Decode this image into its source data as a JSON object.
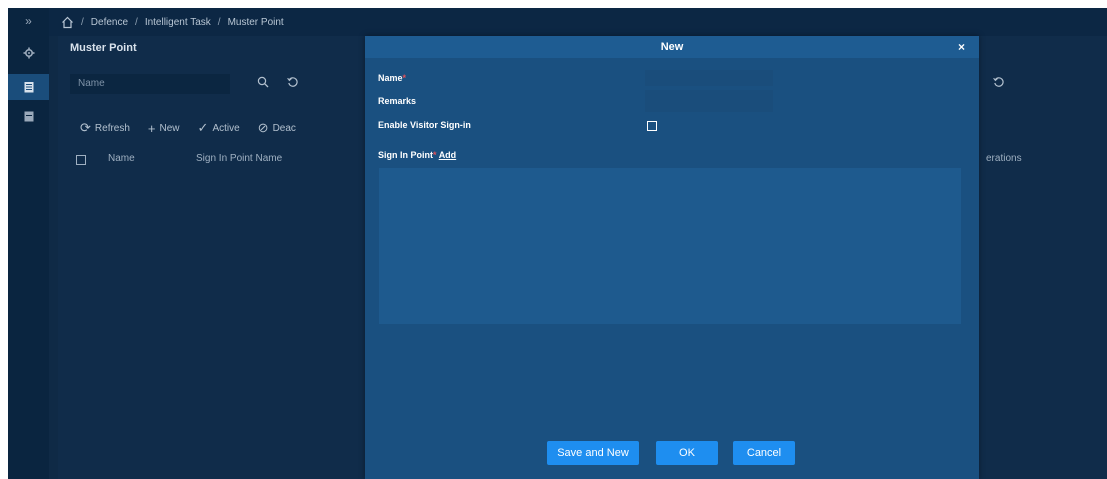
{
  "breadcrumb": {
    "items": [
      "Defence",
      "Intelligent Task",
      "Muster Point"
    ],
    "separator": "/"
  },
  "rail": {
    "expand_glyph": "»",
    "icons": [
      "gear-icon",
      "clipboard-icon",
      "document-icon"
    ]
  },
  "page": {
    "title": "Muster Point",
    "search_placeholder": "Name",
    "toolbar": {
      "refresh": "Refresh",
      "new": "New",
      "active": "Active",
      "deactivate": "Deac"
    },
    "table_headers": {
      "name": "Name",
      "sign_in_point_name": "Sign In Point Name",
      "operations": "erations"
    }
  },
  "modal": {
    "title": "New",
    "close_glyph": "×",
    "fields": {
      "name_label": "Name",
      "name_required": "*",
      "remarks_label": "Remarks",
      "visitor_label": "Enable Visitor Sign-in",
      "sign_in_label": "Sign In Point",
      "sign_in_required": "*",
      "add_link": "Add"
    },
    "buttons": {
      "save_new": "Save and New",
      "ok": "OK",
      "cancel": "Cancel"
    }
  },
  "colors": {
    "background": "#0f2a46",
    "modal": "#1a5080",
    "primary_button": "#1e8ef0",
    "required": "#e0525a"
  }
}
